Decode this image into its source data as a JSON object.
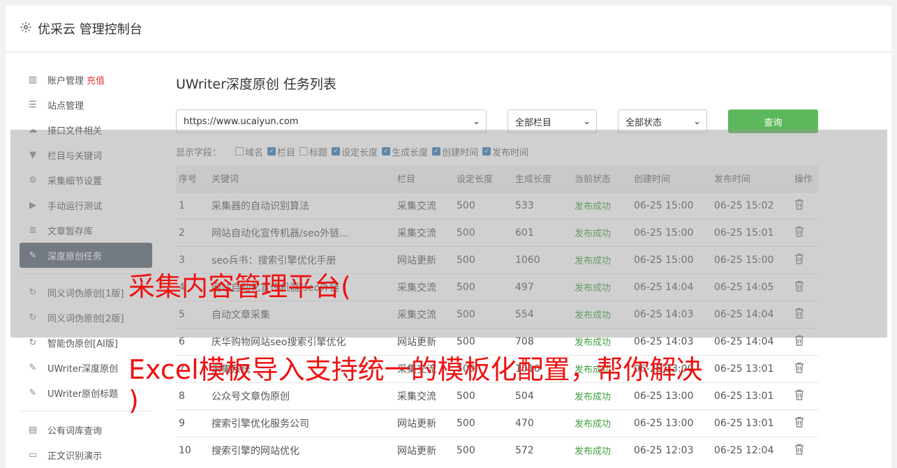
{
  "header": {
    "title": "优采云 管理控制台",
    "gear_icon": "gear-icon"
  },
  "sidebar": {
    "items": [
      {
        "label": "账户管理",
        "extra": "充值",
        "icon": "bar-chart-icon"
      },
      {
        "label": "站点管理",
        "icon": "server-icon"
      },
      {
        "label": "接口文件相关",
        "icon": "cloud-upload-icon"
      },
      {
        "label": "栏目与关键词",
        "icon": "filter-icon"
      },
      {
        "label": "采集细节设置",
        "icon": "cogs-icon"
      },
      {
        "label": "手动运行测试",
        "icon": "play-icon"
      },
      {
        "label": "文章暂存库",
        "icon": "database-icon"
      },
      {
        "label": "深度原创任务",
        "icon": "edit-icon",
        "active": true
      },
      {
        "label": "同义词伪原创[1版]",
        "icon": "refresh-icon"
      },
      {
        "label": "同义词伪原创[2版]",
        "icon": "refresh-icon"
      },
      {
        "label": "智能伪原创[AI版]",
        "icon": "refresh-icon"
      },
      {
        "label": "UWriter深度原创",
        "icon": "edit-icon"
      },
      {
        "label": "UWriter原创标题",
        "icon": "edit-icon"
      },
      {
        "label": "公有词库查询",
        "icon": "book-icon"
      },
      {
        "label": "正文识别演示",
        "icon": "monitor-icon"
      }
    ]
  },
  "main": {
    "title": "UWriter深度原创 任务列表",
    "site_select": "https://www.ucaiyun.com",
    "column_select": "全部栏目",
    "status_select": "全部状态",
    "query_label": "查询",
    "fields_label": "显示字段：",
    "fields": [
      {
        "label": "域名",
        "checked": false
      },
      {
        "label": "栏目",
        "checked": true
      },
      {
        "label": "标题",
        "checked": false
      },
      {
        "label": "设定长度",
        "checked": true
      },
      {
        "label": "生成长度",
        "checked": true
      },
      {
        "label": "创建时间",
        "checked": true
      },
      {
        "label": "发布时间",
        "checked": true
      }
    ],
    "columns": [
      "序号",
      "关键词",
      "栏目",
      "设定长度",
      "生成长度",
      "当前状态",
      "创建时间",
      "发布时间",
      "操作"
    ],
    "rows": [
      [
        "1",
        "采集器的自动识别算法",
        "采集交流",
        "500",
        "533",
        "发布成功",
        "06-25 15:00",
        "06-25 15:02"
      ],
      [
        "2",
        "网站自动化宣传机器/seo外链...",
        "采集交流",
        "500",
        "601",
        "发布成功",
        "06-25 15:00",
        "06-25 15:01"
      ],
      [
        "3",
        "seo兵书：搜索引擎优化手册",
        "网站更新",
        "500",
        "1060",
        "发布成功",
        "06-25 15:00",
        "06-25 15:00"
      ],
      [
        "4",
        "网站自动化宣传机器/seo外链",
        "采集交流",
        "500",
        "497",
        "发布成功",
        "06-25 14:04",
        "06-25 14:05"
      ],
      [
        "5",
        "自动文章采集",
        "采集交流",
        "500",
        "554",
        "发布成功",
        "06-25 14:03",
        "06-25 14:04"
      ],
      [
        "6",
        "庆华购物网站seo搜索引擎优化",
        "网站更新",
        "500",
        "708",
        "发布成功",
        "06-25 14:03",
        "06-25 14:04"
      ],
      [
        "7",
        "采集系统",
        "采集交流",
        "500",
        "1016",
        "发布成功",
        "06-25 13:00",
        "06-25 13:01"
      ],
      [
        "8",
        "公众号文章伪原创",
        "采集交流",
        "500",
        "504",
        "发布成功",
        "06-25 13:00",
        "06-25 13:01"
      ],
      [
        "9",
        "搜索引擎优化服务公司",
        "网站更新",
        "500",
        "470",
        "发布成功",
        "06-25 13:00",
        "06-25 13:01"
      ],
      [
        "10",
        "搜索引擎的网站优化",
        "网站更新",
        "500",
        "572",
        "发布成功",
        "06-25 12:03",
        "06-25 12:04"
      ]
    ]
  },
  "overlay_text": {
    "line1": "采集内容管理平台(",
    "line2": "Excel模板导入支持统一的模板化配置，帮你解决",
    "line3": ")"
  }
}
